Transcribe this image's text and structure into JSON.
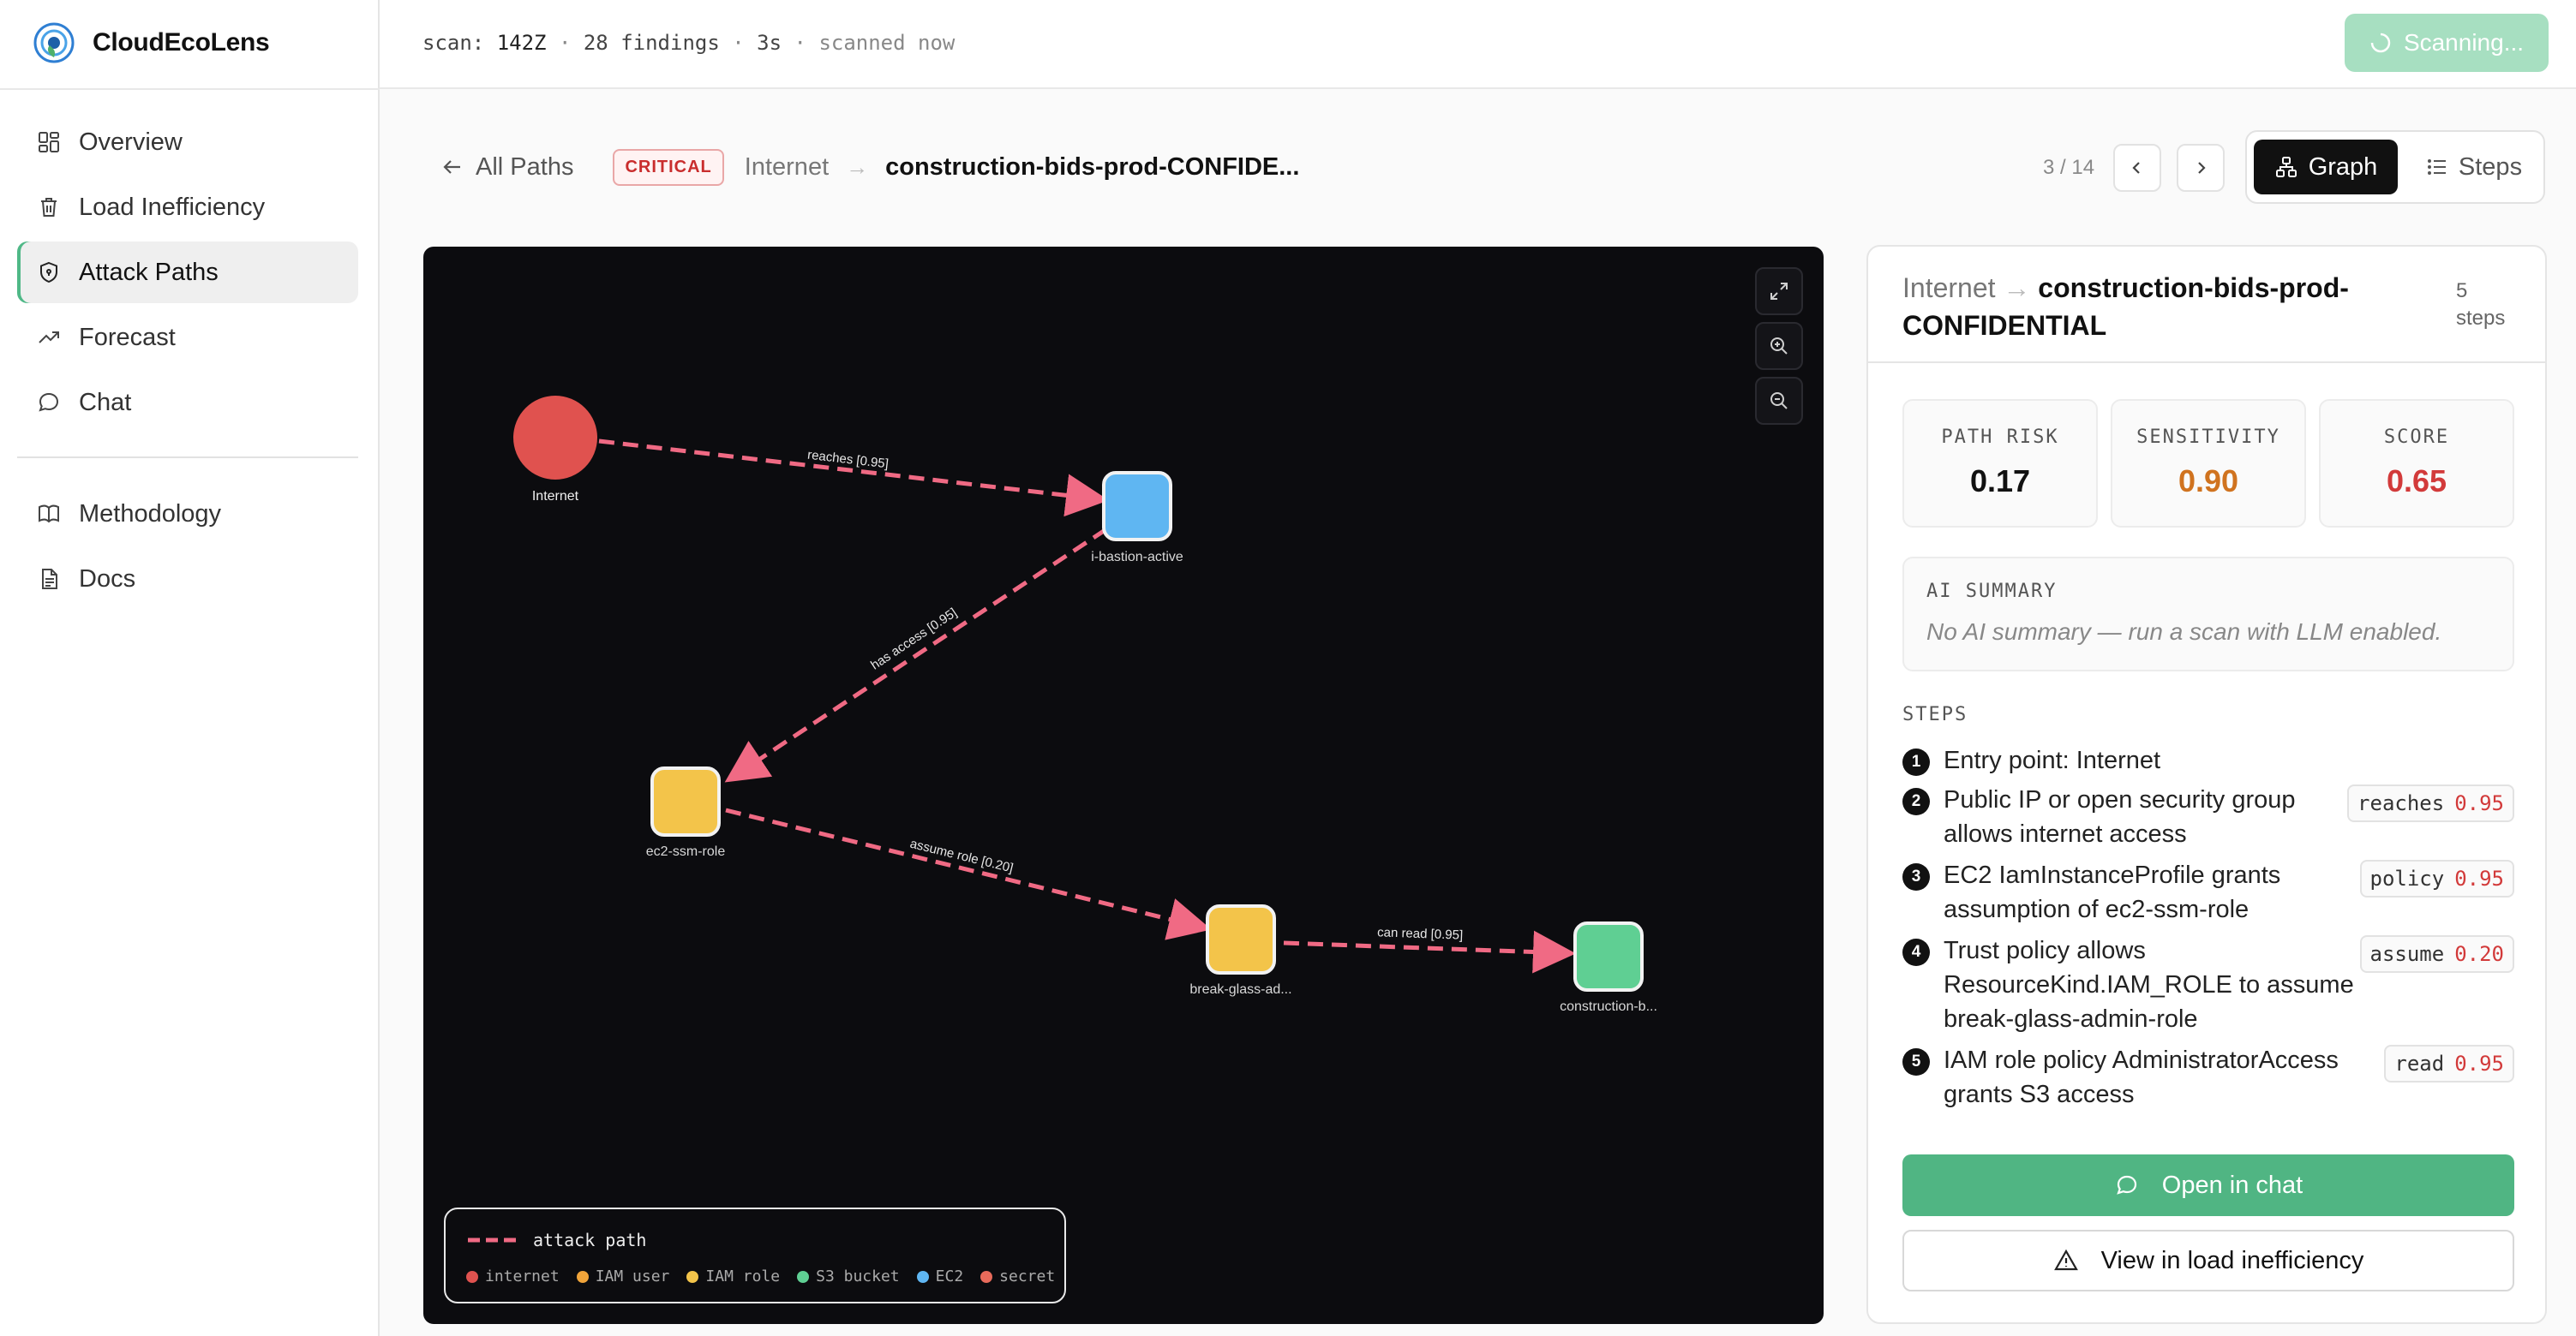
{
  "app": {
    "name": "CloudEcoLens"
  },
  "sidebar": {
    "items": [
      {
        "label": "Overview",
        "icon": "grid-icon"
      },
      {
        "label": "Load Inefficiency",
        "icon": "trash-icon"
      },
      {
        "label": "Attack Paths",
        "icon": "shield-icon",
        "active": true
      },
      {
        "label": "Forecast",
        "icon": "trend-icon"
      },
      {
        "label": "Chat",
        "icon": "chat-icon"
      }
    ],
    "secondary": [
      {
        "label": "Methodology",
        "icon": "book-icon"
      },
      {
        "label": "Docs",
        "icon": "doc-icon"
      }
    ]
  },
  "topbar": {
    "scan_label": "scan:",
    "scan_id": "142Z",
    "sep1": "·",
    "findings": "28 findings",
    "sep2": "·",
    "duration": "3s",
    "sep3": "·",
    "status": "scanned now",
    "scan_button": "Scanning..."
  },
  "header": {
    "back_label": "All Paths",
    "severity": "CRITICAL",
    "source": "Internet",
    "arrow": "→",
    "target": "construction-bids-prod-CONFIDE...",
    "pager": "3 / 14",
    "view_graph": "Graph",
    "view_steps": "Steps"
  },
  "graph": {
    "nodes": [
      {
        "label": "Internet",
        "kind": "internet"
      },
      {
        "label": "i-bastion-active",
        "kind": "ec2"
      },
      {
        "label": "ec2-ssm-role",
        "kind": "iam_role"
      },
      {
        "label": "break-glass-ad...",
        "kind": "iam_role"
      },
      {
        "label": "construction-b...",
        "kind": "s3_bucket"
      }
    ],
    "edges": [
      {
        "label": "reaches [0.95]"
      },
      {
        "label": "has access [0.95]"
      },
      {
        "label": "assume role [0.20]"
      },
      {
        "label": "can read [0.95]"
      }
    ],
    "legend": {
      "path_label": "attack path",
      "items": [
        {
          "label": "internet",
          "color": "#e0524f"
        },
        {
          "label": "IAM user",
          "color": "#f0a43a"
        },
        {
          "label": "IAM role",
          "color": "#f3c44a"
        },
        {
          "label": "S3 bucket",
          "color": "#5fcf93"
        },
        {
          "label": "EC2",
          "color": "#5fb6f2"
        },
        {
          "label": "secret",
          "color": "#e86b5b"
        }
      ]
    }
  },
  "detail": {
    "title_source": "Internet",
    "title_arrow": "→",
    "title_target": "construction-bids-prod-CONFIDENTIAL",
    "steps_count": "5",
    "steps_word": "steps",
    "metrics": [
      {
        "label": "PATH RISK",
        "value": "0.17",
        "color": "#111111"
      },
      {
        "label": "SENSITIVITY",
        "value": "0.90",
        "color": "#d0731f"
      },
      {
        "label": "SCORE",
        "value": "0.65",
        "color": "#d23a3a"
      }
    ],
    "ai_label": "AI SUMMARY",
    "ai_text": "No AI summary — run a scan with LLM enabled.",
    "steps_label": "STEPS",
    "steps": [
      {
        "num": "1",
        "text": "Entry point: Internet",
        "tag": "",
        "tag_val": ""
      },
      {
        "num": "2",
        "text": "Public IP or open security group allows internet access",
        "tag": "reaches",
        "tag_val": "0.95"
      },
      {
        "num": "3",
        "text": "EC2 IamInstanceProfile grants assumption of ec2-ssm-role",
        "tag": "policy",
        "tag_val": "0.95"
      },
      {
        "num": "4",
        "text": "Trust policy allows ResourceKind.IAM_ROLE to assume break-glass-admin-role",
        "tag": "assume",
        "tag_val": "0.20"
      },
      {
        "num": "5",
        "text": "IAM role policy AdministratorAccess grants S3 access",
        "tag": "read",
        "tag_val": "0.95"
      }
    ],
    "open_chat": "Open in chat",
    "view_load": "View in load inefficiency"
  }
}
